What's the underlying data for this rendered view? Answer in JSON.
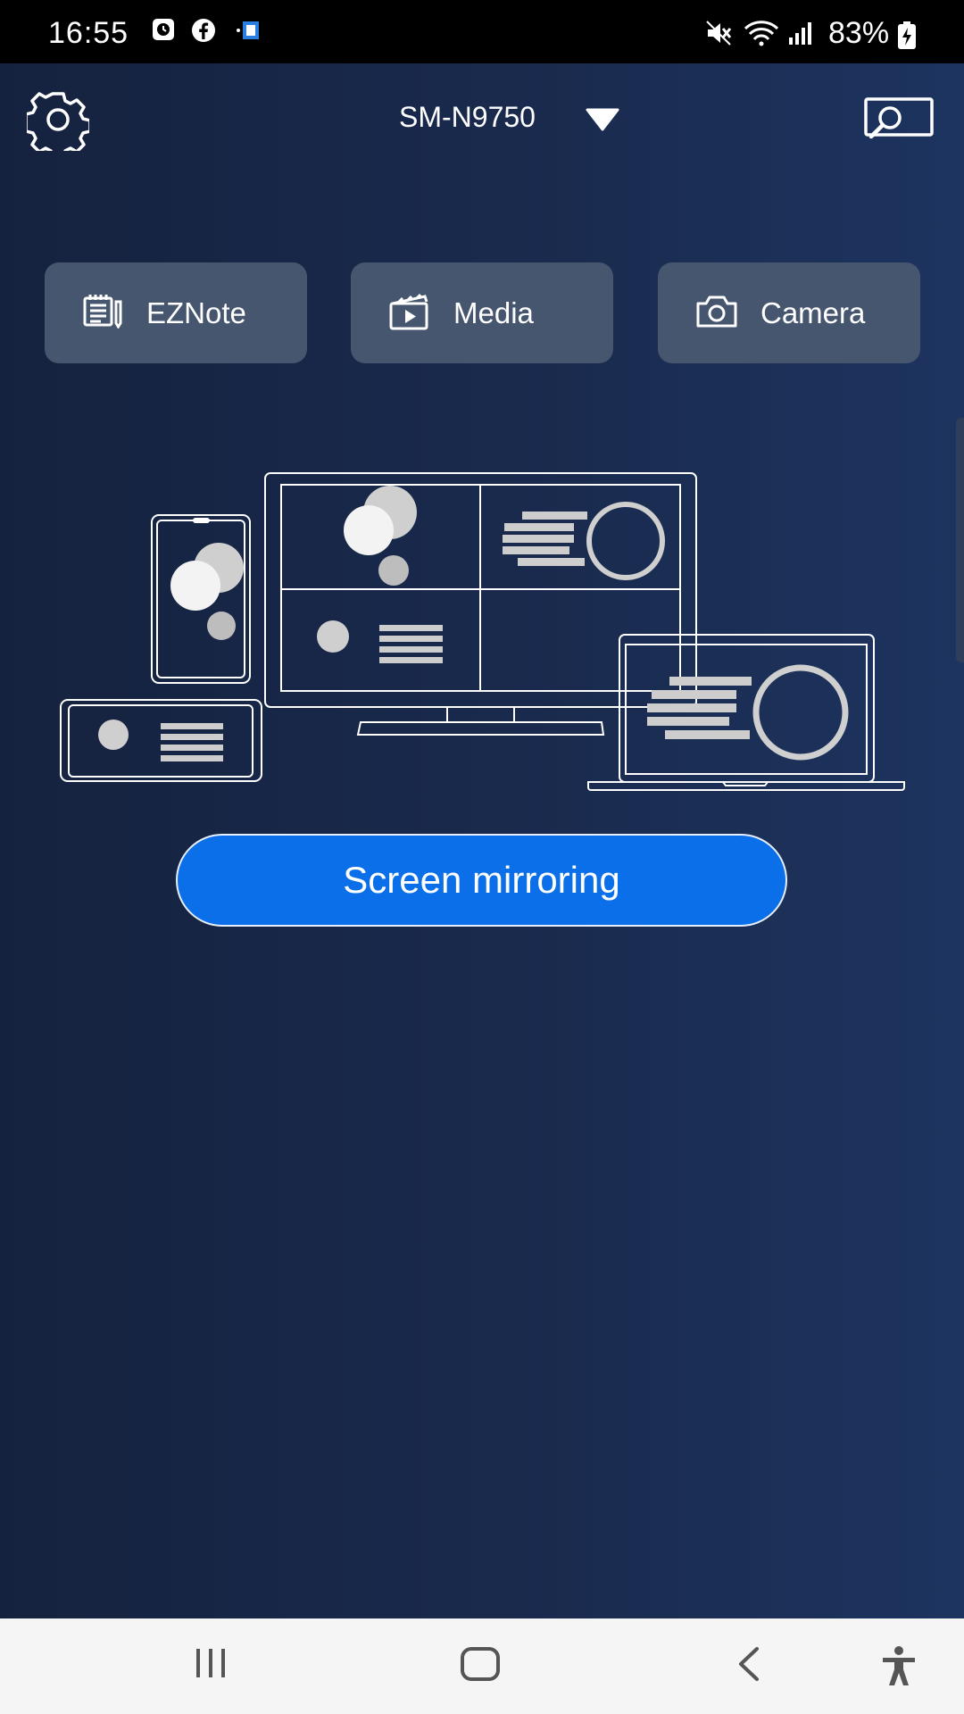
{
  "status_bar": {
    "time": "16:55",
    "battery_percent": "83%",
    "left_icons": [
      "clock-app-icon",
      "facebook-icon",
      "cast-app-icon"
    ],
    "right_icons": [
      "mute-icon",
      "wifi-icon",
      "signal-icon",
      "battery-charging-icon"
    ]
  },
  "app_bar": {
    "device_name": "SM-N9750",
    "left_icon": "gear-icon",
    "right_icon": "cast-search-icon",
    "dropdown_icon": "triangle-down-icon"
  },
  "quick_actions": [
    {
      "label": "EZNote",
      "icon": "note-icon"
    },
    {
      "label": "Media",
      "icon": "media-icon"
    },
    {
      "label": "Camera",
      "icon": "camera-icon"
    }
  ],
  "main": {
    "primary_button_label": "Screen mirroring",
    "illustration": "multi-device-illustration"
  },
  "nav_bar": {
    "items": [
      "recent-apps-icon",
      "home-icon",
      "back-icon",
      "accessibility-icon"
    ]
  },
  "colors": {
    "primary": "#0a6fe8",
    "background": "#1a2b4f",
    "tile": "#46566f"
  }
}
